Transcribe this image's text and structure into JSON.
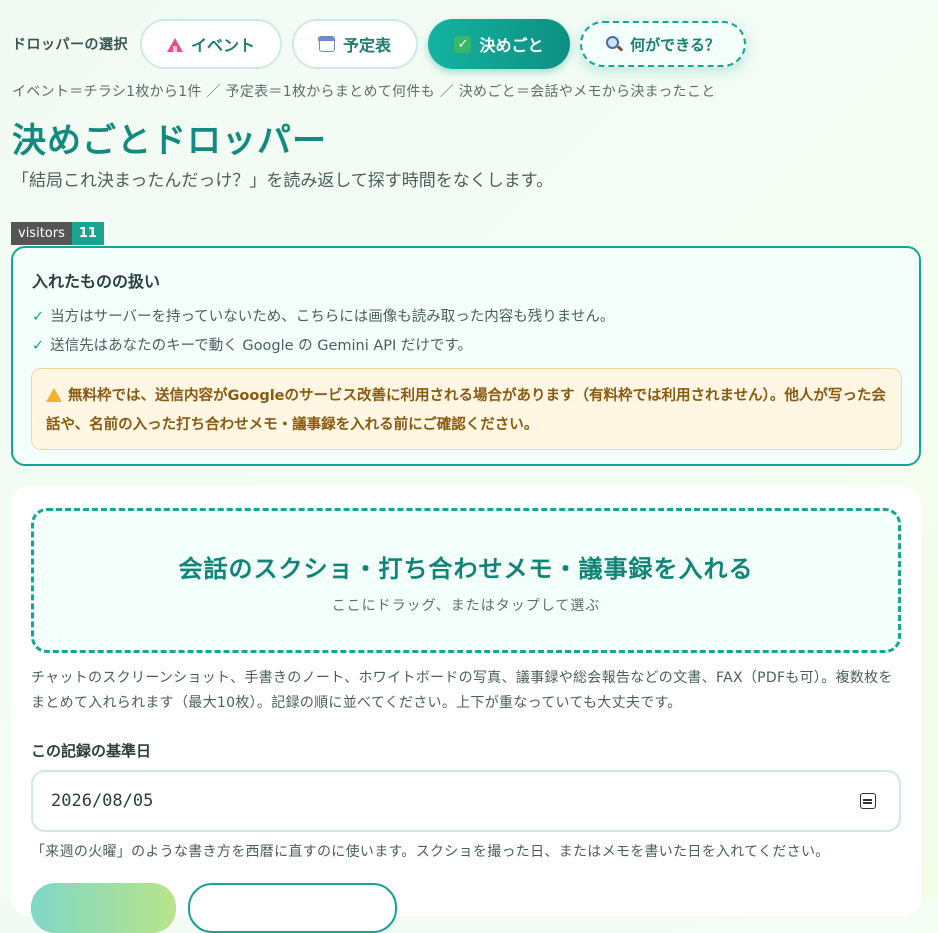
{
  "nav": {
    "label": "ドロッパーの選択",
    "event": "イベント",
    "schedule": "予定表",
    "decision": "決めごと",
    "what": "何ができる？"
  },
  "subnav": "イベント＝チラシ1枚から1件 ／ 予定表＝1枚からまとめて何件も ／ 決めごと＝会話やメモから決まったこと",
  "title": "決めごとドロッパー",
  "tagline": "「結局これ決まったんだっけ？」を読み返して探す時間をなくします。",
  "visitors": {
    "label": "visitors",
    "count": "11"
  },
  "privacy": {
    "heading": "入れたものの扱い",
    "items": [
      "当方はサーバーを持っていないため、こちらには画像も読み取った内容も残りません。",
      "送信先はあなたのキーで動く Google の Gemini API だけです。"
    ],
    "warning": "無料枠では、送信内容がGoogleのサービス改善に利用される場合があります（有料枠では利用されません）。他人が写った会話や、名前の入った打ち合わせメモ・議事録を入れる前にご確認ください。"
  },
  "drop": {
    "title": "会話のスクショ・打ち合わせメモ・議事録を入れる",
    "sub": "ここにドラッグ、またはタップして選ぶ"
  },
  "description": "チャットのスクリーンショット、手書きのノート、ホワイトボードの写真、議事録や総会報告などの文書、FAX（PDFも可）。複数枚をまとめて入れられます（最大10枚）。記録の順に並べてください。上下が重なっていても大丈夫です。",
  "date": {
    "label": "この記録の基準日",
    "value": "2026/08/05",
    "hint": "「来週の火曜」のような書き方を西暦に直すのに使います。スクショを撮った日、またはメモを書いた日を入れてください。"
  },
  "colors": {
    "accent": "#14a593",
    "warning_bg": "#fff6e3",
    "warning_text": "#8a5a10"
  }
}
